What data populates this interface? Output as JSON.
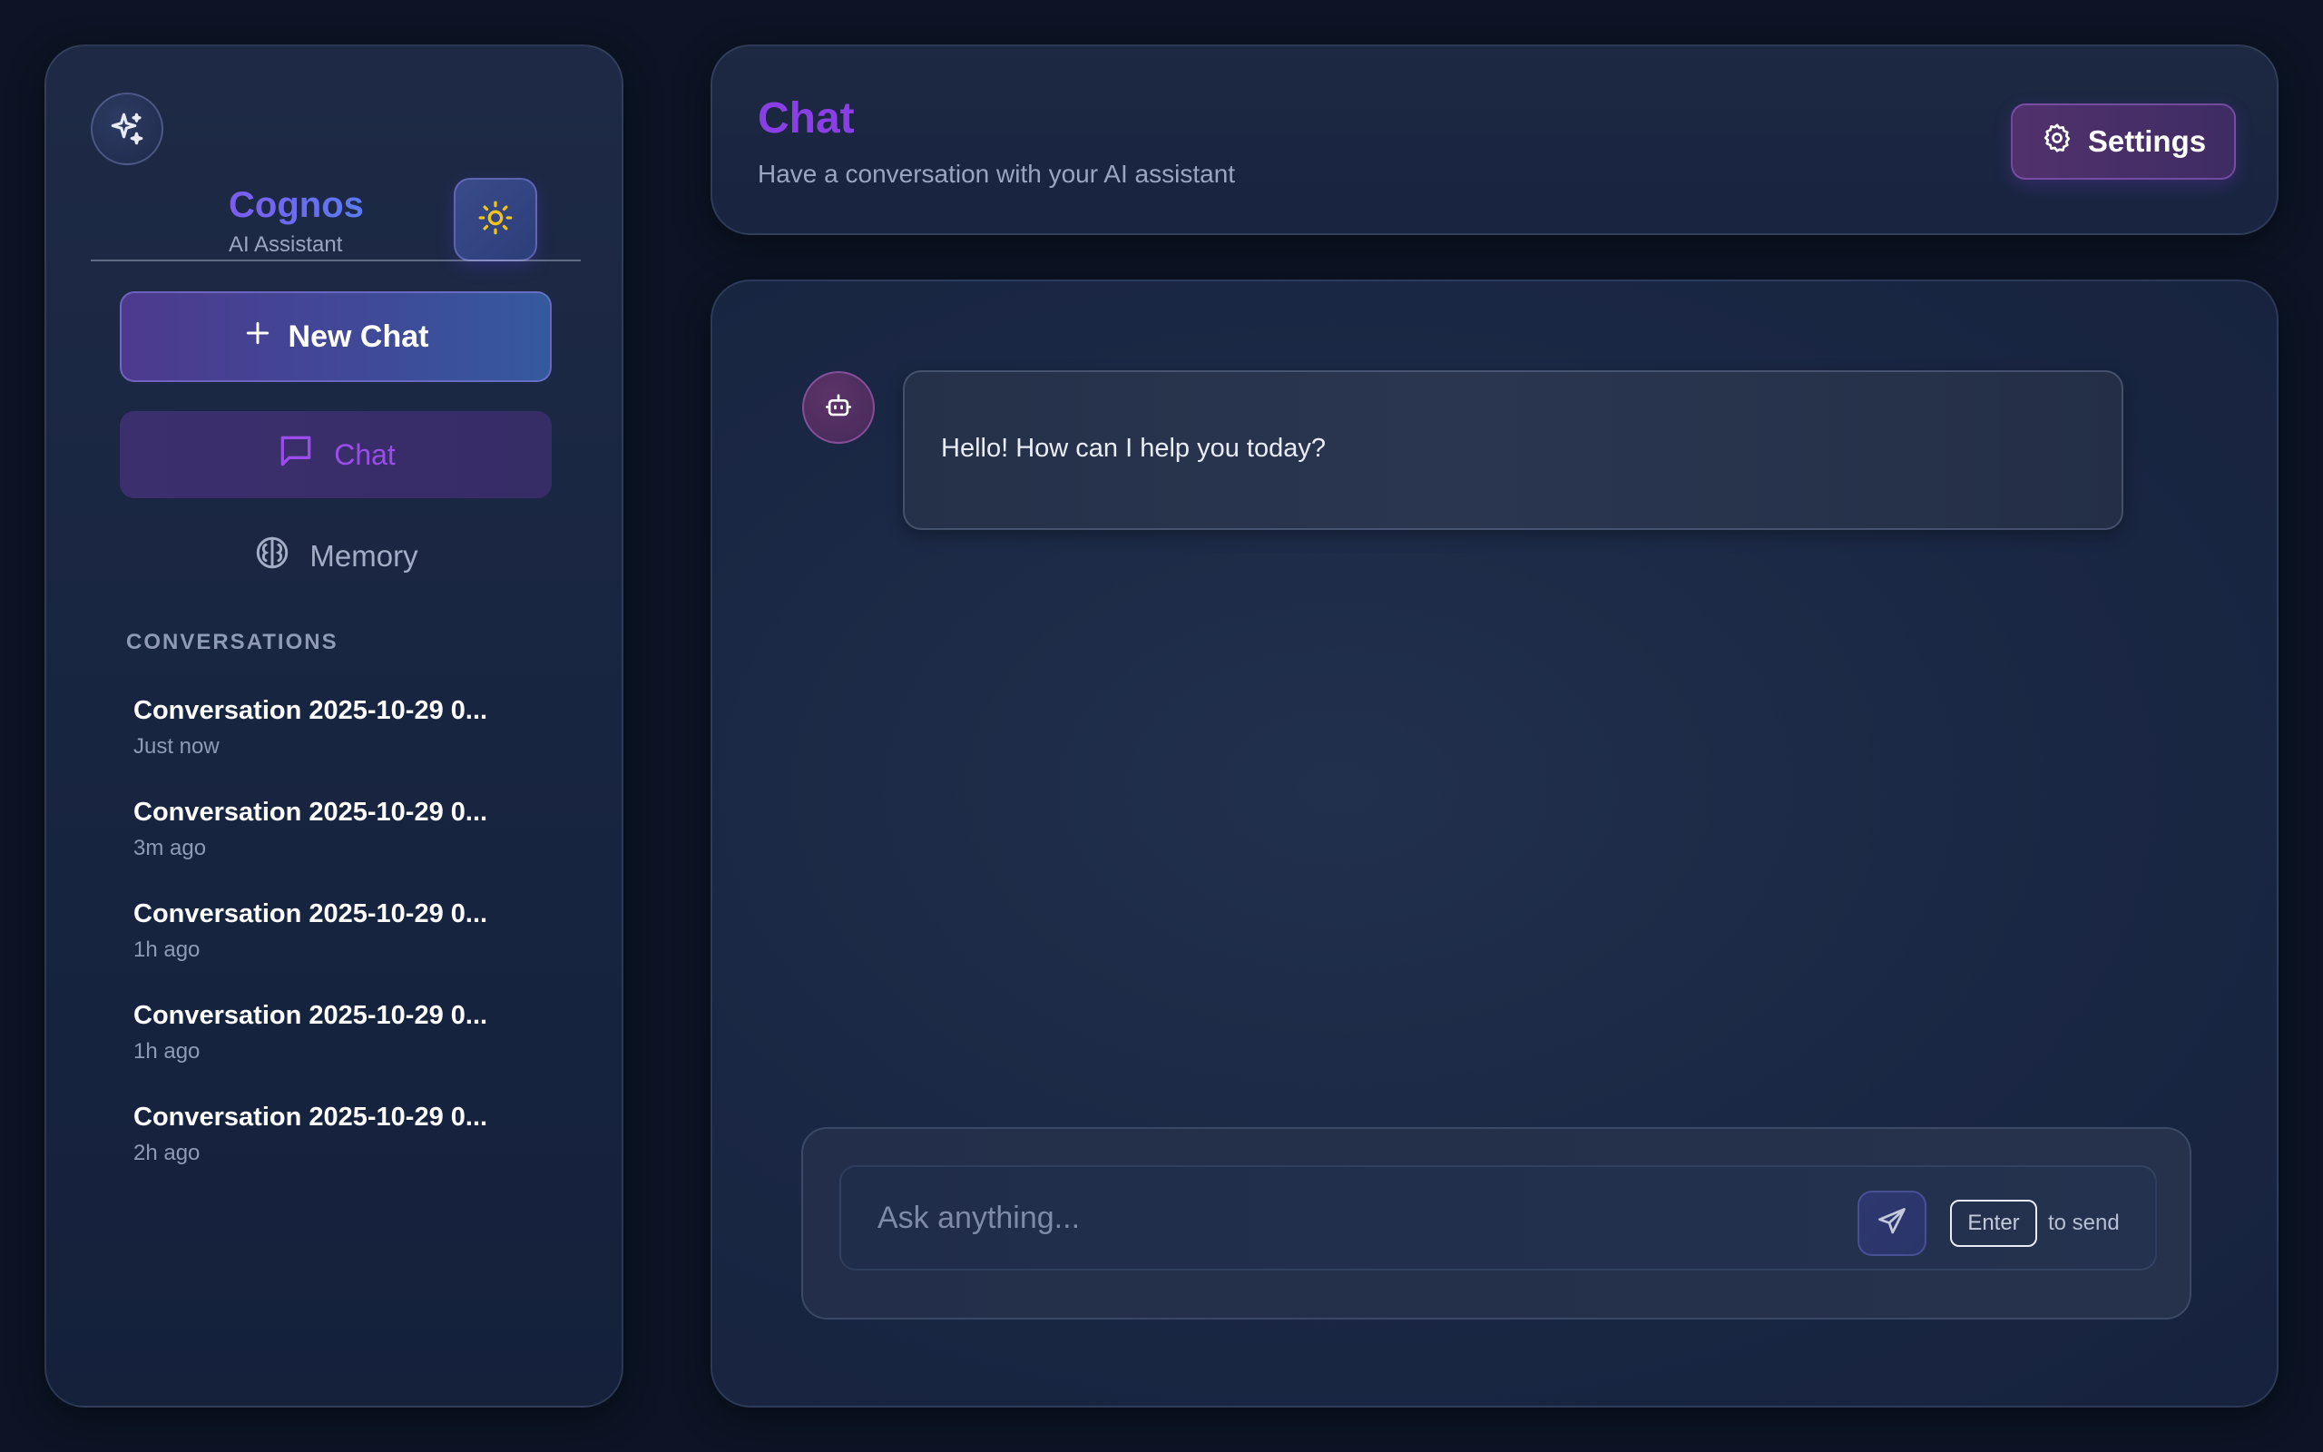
{
  "brand": {
    "name": "Cognos",
    "subtitle": "AI Assistant"
  },
  "sidebar": {
    "new_chat_label": "New Chat",
    "nav": [
      {
        "label": "Chat",
        "icon": "chat-bubble-icon",
        "active": true
      },
      {
        "label": "Memory",
        "icon": "brain-icon",
        "active": false
      }
    ],
    "conversations_heading": "CONVERSATIONS",
    "conversations": [
      {
        "title": "Conversation 2025-10-29 0...",
        "time": "Just now"
      },
      {
        "title": "Conversation 2025-10-29 0...",
        "time": "3m ago"
      },
      {
        "title": "Conversation 2025-10-29 0...",
        "time": "1h ago"
      },
      {
        "title": "Conversation 2025-10-29 0...",
        "time": "1h ago"
      },
      {
        "title": "Conversation 2025-10-29 0...",
        "time": "2h ago"
      }
    ]
  },
  "header": {
    "title": "Chat",
    "subtitle": "Have a conversation with your AI assistant",
    "settings_label": "Settings"
  },
  "messages": [
    {
      "role": "assistant",
      "text": "Hello! How can I help you today?"
    }
  ],
  "composer": {
    "placeholder": "Ask anything...",
    "value": "",
    "key_hint": "Enter",
    "hint_suffix": "to send"
  },
  "colors": {
    "accent_purple": "#8a3fe6",
    "accent_blue": "#5a7cf2",
    "background": "#0c1425",
    "sun_icon": "#f0c419"
  }
}
